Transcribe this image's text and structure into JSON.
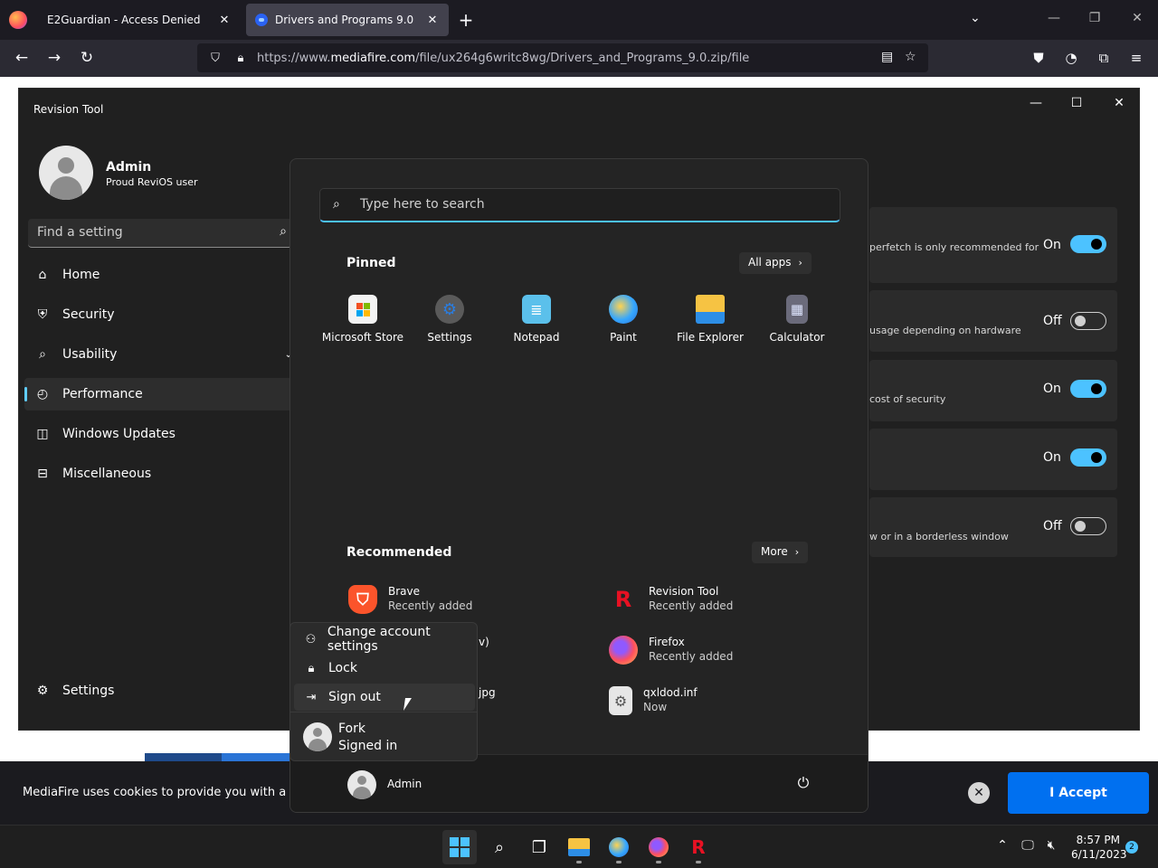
{
  "browser": {
    "tabs": [
      {
        "title": "E2Guardian - Access Denied",
        "close": "✕"
      },
      {
        "title": "Drivers and Programs 9.0",
        "close": "✕"
      }
    ],
    "new_tab": "+",
    "url_host": "mediafire.com",
    "url_prefix": "https://www.",
    "url_path": "/file/ux264g6writc8wg/Drivers_and_Programs_9.0.zip/file"
  },
  "revision_tool": {
    "title": "Revision Tool",
    "user_name": "Admin",
    "user_sub": "Proud ReviOS user",
    "find_placeholder": "Find a setting",
    "nav": [
      {
        "label": "Home",
        "icon": "home-icon"
      },
      {
        "label": "Security",
        "icon": "shield-icon"
      },
      {
        "label": "Usability",
        "icon": "search-icon"
      },
      {
        "label": "Performance",
        "icon": "gauge-icon"
      },
      {
        "label": "Windows Updates",
        "icon": "update-icon"
      },
      {
        "label": "Miscellaneous",
        "icon": "toolbox-icon"
      }
    ],
    "settings_label": "Settings",
    "cards": [
      {
        "desc": "perfetch is only recommended for",
        "state": "On"
      },
      {
        "desc": "usage depending on hardware",
        "state": "Off"
      },
      {
        "desc": "cost of security",
        "state": "On"
      },
      {
        "desc": "",
        "state": "On"
      },
      {
        "desc": "w or in a borderless window",
        "state": "Off"
      }
    ]
  },
  "start_menu": {
    "search_placeholder": "Type here to search",
    "pinned_title": "Pinned",
    "all_apps": "All apps",
    "pinned": [
      {
        "name": "Microsoft Store",
        "icon": "store-icon"
      },
      {
        "name": "Settings",
        "icon": "gear-icon"
      },
      {
        "name": "Notepad",
        "icon": "notepad-icon"
      },
      {
        "name": "Paint",
        "icon": "palette-icon"
      },
      {
        "name": "File Explorer",
        "icon": "folder-icon"
      },
      {
        "name": "Calculator",
        "icon": "calculator-icon"
      }
    ],
    "recommended_title": "Recommended",
    "more": "More",
    "recommended": [
      {
        "name": "Brave",
        "sub": "Recently added",
        "icon": "brave-icon"
      },
      {
        "name": "Revision Tool",
        "sub": "Recently added",
        "icon": "revision-icon"
      },
      {
        "name": "v)",
        "sub": "",
        "icon": ""
      },
      {
        "name": "Firefox",
        "sub": "Recently added",
        "icon": "firefox-icon"
      },
      {
        "name": "jpg",
        "sub": "",
        "icon": ""
      },
      {
        "name": "qxldod.inf",
        "sub": "Now",
        "icon": "inf-file-icon"
      }
    ],
    "footer_user": "Admin"
  },
  "account_menu": {
    "items": [
      "Change account settings",
      "Lock",
      "Sign out"
    ],
    "user_name": "Fork",
    "user_status": "Signed in"
  },
  "cookie": {
    "text": "MediaFire uses cookies to provide you with a perso",
    "accept": "I Accept"
  },
  "taskbar": {
    "time": "8:57 PM",
    "date": "6/11/2023",
    "notifications": "2"
  }
}
